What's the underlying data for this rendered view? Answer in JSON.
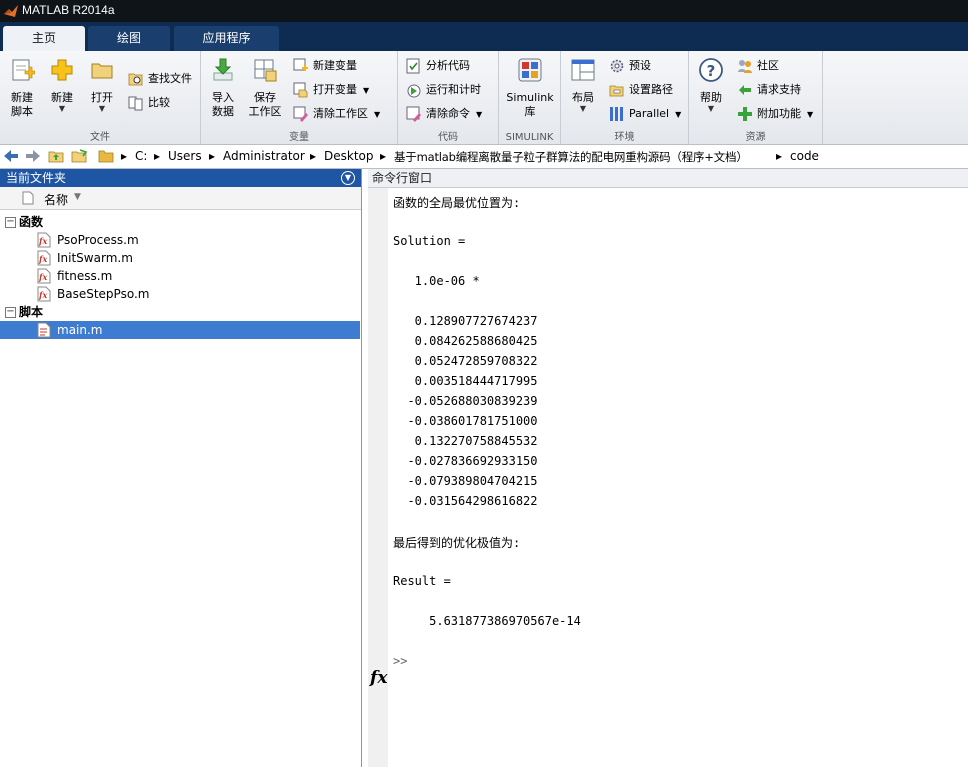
{
  "window": {
    "title": "MATLAB R2014a"
  },
  "tabs": [
    {
      "label": "主页",
      "active": true
    },
    {
      "label": "绘图",
      "active": false
    },
    {
      "label": "应用程序",
      "active": false
    }
  ],
  "ribbon": {
    "file": {
      "section_label": "文件",
      "new_script": "新建\n脚本",
      "new": "新建",
      "open": "打开",
      "find_files": "查找文件",
      "compare": "比较"
    },
    "variable": {
      "section_label": "变量",
      "import_data": "导入\n数据",
      "save_workspace": "保存\n工作区",
      "new_variable": "新建变量",
      "open_variable": "打开变量",
      "clear_workspace": "清除工作区"
    },
    "code": {
      "section_label": "代码",
      "analyze_code": "分析代码",
      "run_and_time": "运行和计时",
      "clear_commands": "清除命令"
    },
    "simulink": {
      "section_label": "SIMULINK",
      "library": "Simulink\n库"
    },
    "environment": {
      "section_label": "环境",
      "layout": "布局",
      "preferences": "预设",
      "set_path": "设置路径",
      "parallel": "Parallel"
    },
    "resources": {
      "section_label": "资源",
      "help": "帮助",
      "community": "社区",
      "request_support": "请求支持",
      "addons": "附加功能"
    }
  },
  "address": {
    "segments": [
      "C:",
      "Users",
      "Administrator",
      "Desktop",
      "基于matlab编程离散量子粒子群算法的配电网重构源码（程序+文档）",
      "code"
    ]
  },
  "current_folder": {
    "title": "当前文件夹",
    "column_name": "名称",
    "groups": [
      {
        "label": "函数",
        "files": [
          "PsoProcess.m",
          "InitSwarm.m",
          "fitness.m",
          "BaseStepPso.m"
        ]
      },
      {
        "label": "脚本",
        "files": [
          "main.m"
        ]
      }
    ],
    "selected_file": "main.m"
  },
  "command_window": {
    "title": "命令行窗口",
    "lines": [
      "函数的全局最优位置为:",
      "",
      "Solution =",
      "",
      "   1.0e-06 *",
      "",
      "   0.128907727674237",
      "   0.084262588680425",
      "   0.052472859708322",
      "   0.003518444717995",
      "  -0.052688030839239",
      "  -0.038601781751000",
      "   0.132270758845532",
      "  -0.027836692933150",
      "  -0.079389804704215",
      "  -0.031564298616822",
      "",
      "最后得到的优化极值为:",
      "",
      "Result =",
      "",
      "     5.631877386970567e-14",
      "",
      ">>"
    ],
    "fx_label": "fx"
  }
}
